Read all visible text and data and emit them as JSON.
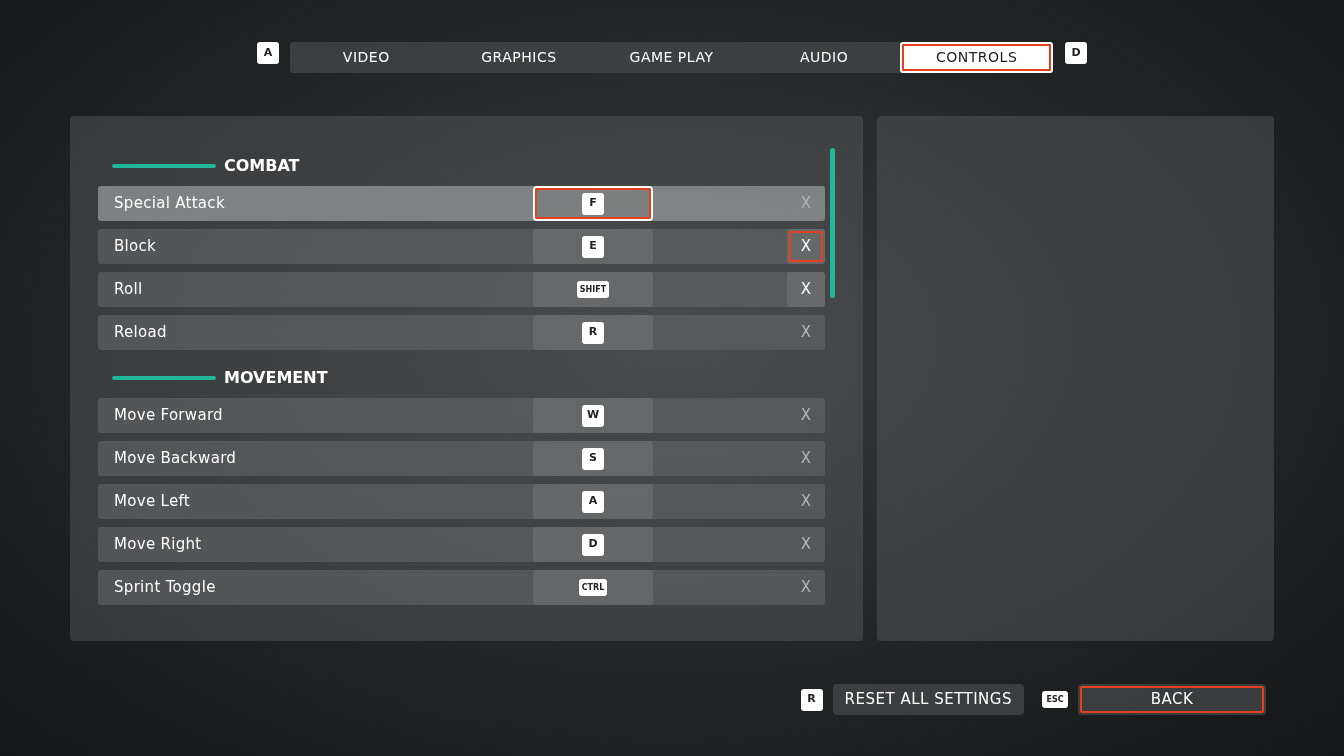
{
  "tabs_prev_key": "A",
  "tabs_next_key": "D",
  "tabs": [
    {
      "label": "VIDEO",
      "selected": false,
      "highlighted": false
    },
    {
      "label": "GRAPHICS",
      "selected": false,
      "highlighted": false
    },
    {
      "label": "GAME PLAY",
      "selected": false,
      "highlighted": false
    },
    {
      "label": "AUDIO",
      "selected": false,
      "highlighted": false
    },
    {
      "label": "CONTROLS",
      "selected": true,
      "highlighted": true
    }
  ],
  "sections": [
    {
      "title": "COMBAT",
      "rows": [
        {
          "action": "Special Attack",
          "key": "F",
          "selected": true,
          "key_highlighted": true,
          "clear": "X",
          "clear_enabled": false,
          "clear_highlighted": false
        },
        {
          "action": "Block",
          "key": "E",
          "selected": false,
          "key_highlighted": false,
          "clear": "X",
          "clear_enabled": true,
          "clear_highlighted": true
        },
        {
          "action": "Roll",
          "key": "SHIFT",
          "selected": false,
          "key_highlighted": false,
          "clear": "X",
          "clear_enabled": true,
          "clear_highlighted": false
        },
        {
          "action": "Reload",
          "key": "R",
          "selected": false,
          "key_highlighted": false,
          "clear": "X",
          "clear_enabled": false,
          "clear_highlighted": false
        }
      ]
    },
    {
      "title": "MOVEMENT",
      "rows": [
        {
          "action": "Move Forward",
          "key": "W",
          "selected": false,
          "key_highlighted": false,
          "clear": "X",
          "clear_enabled": false,
          "clear_highlighted": false
        },
        {
          "action": "Move Backward",
          "key": "S",
          "selected": false,
          "key_highlighted": false,
          "clear": "X",
          "clear_enabled": false,
          "clear_highlighted": false
        },
        {
          "action": "Move Left",
          "key": "A",
          "selected": false,
          "key_highlighted": false,
          "clear": "X",
          "clear_enabled": false,
          "clear_highlighted": false
        },
        {
          "action": "Move Right",
          "key": "D",
          "selected": false,
          "key_highlighted": false,
          "clear": "X",
          "clear_enabled": false,
          "clear_highlighted": false
        },
        {
          "action": "Sprint Toggle",
          "key": "CTRL",
          "selected": false,
          "key_highlighted": false,
          "clear": "X",
          "clear_enabled": false,
          "clear_highlighted": false
        }
      ]
    }
  ],
  "footer": [
    {
      "key": "R",
      "label": "RESET ALL SETTINGS",
      "highlighted": false
    },
    {
      "key": "ESC",
      "label": "BACK",
      "highlighted": true
    }
  ]
}
